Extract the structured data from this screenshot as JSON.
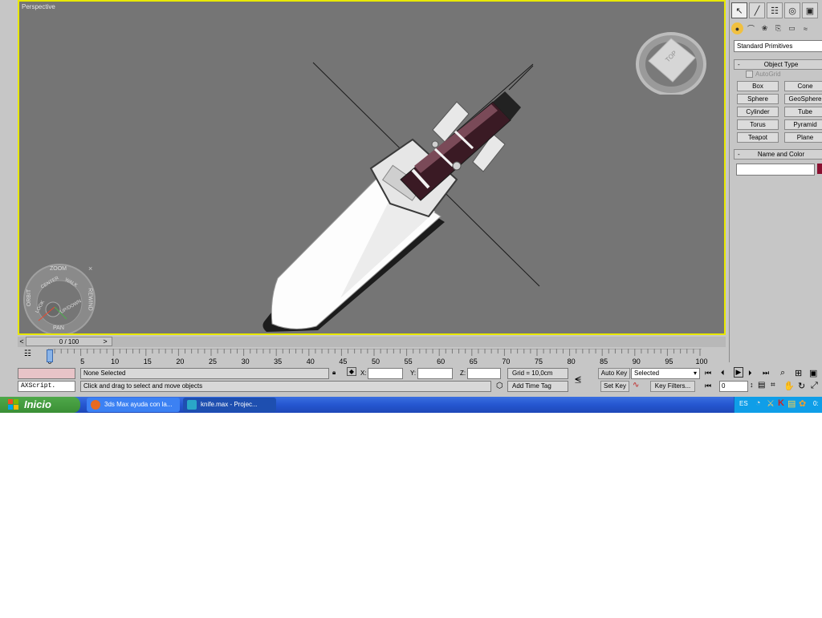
{
  "viewport": {
    "label": "Perspective",
    "viewcube_label": "TOP"
  },
  "nav_wheel": {
    "labels": [
      "ZOOM",
      "ORBIT",
      "CENTER",
      "WALK",
      "REWIND",
      "LOOK",
      "UP/DOWN",
      "PAN"
    ],
    "close": "×"
  },
  "command_panel": {
    "category_dropdown": "Standard Primitives",
    "object_type": {
      "title": "Object Type",
      "autogrid": "AutoGrid",
      "buttons": [
        "Box",
        "Cone",
        "Sphere",
        "GeoSphere",
        "Cylinder",
        "Tube",
        "Torus",
        "Pyramid",
        "Teapot",
        "Plane"
      ]
    },
    "name_color": {
      "title": "Name and Color",
      "name_value": "",
      "color": "#8a1030"
    },
    "collapse_symbol": "-"
  },
  "time_slider": {
    "position": "0 / 100",
    "current_frame": 0,
    "total_frames": 100,
    "left_arrow": "<",
    "right_arrow": ">"
  },
  "track_bar": {
    "ticks": [
      "0",
      "5",
      "10",
      "15",
      "20",
      "25",
      "30",
      "35",
      "40",
      "45",
      "50",
      "55",
      "60",
      "65",
      "70",
      "75",
      "80",
      "85",
      "90",
      "95",
      "100"
    ]
  },
  "status_bar": {
    "maxscript_label": "AXScript.",
    "selection_status": "None Selected",
    "prompt": "Click and drag to select and move objects",
    "x_label": "X:",
    "y_label": "Y:",
    "z_label": "Z:",
    "x_value": "",
    "y_value": "",
    "z_value": "",
    "grid": "Grid = 10,0cm",
    "add_time_tag": "Add Time Tag",
    "auto_key": "Auto Key",
    "set_key": "Set Key",
    "selected_dropdown": "Selected",
    "key_filters": "Key Filters...",
    "frame_field": "0"
  },
  "taskbar": {
    "start": "Inicio",
    "tasks": [
      "3ds Max ayuda con la...",
      "knife.max    - Projec..."
    ],
    "language": "ES",
    "clock": "0:"
  }
}
